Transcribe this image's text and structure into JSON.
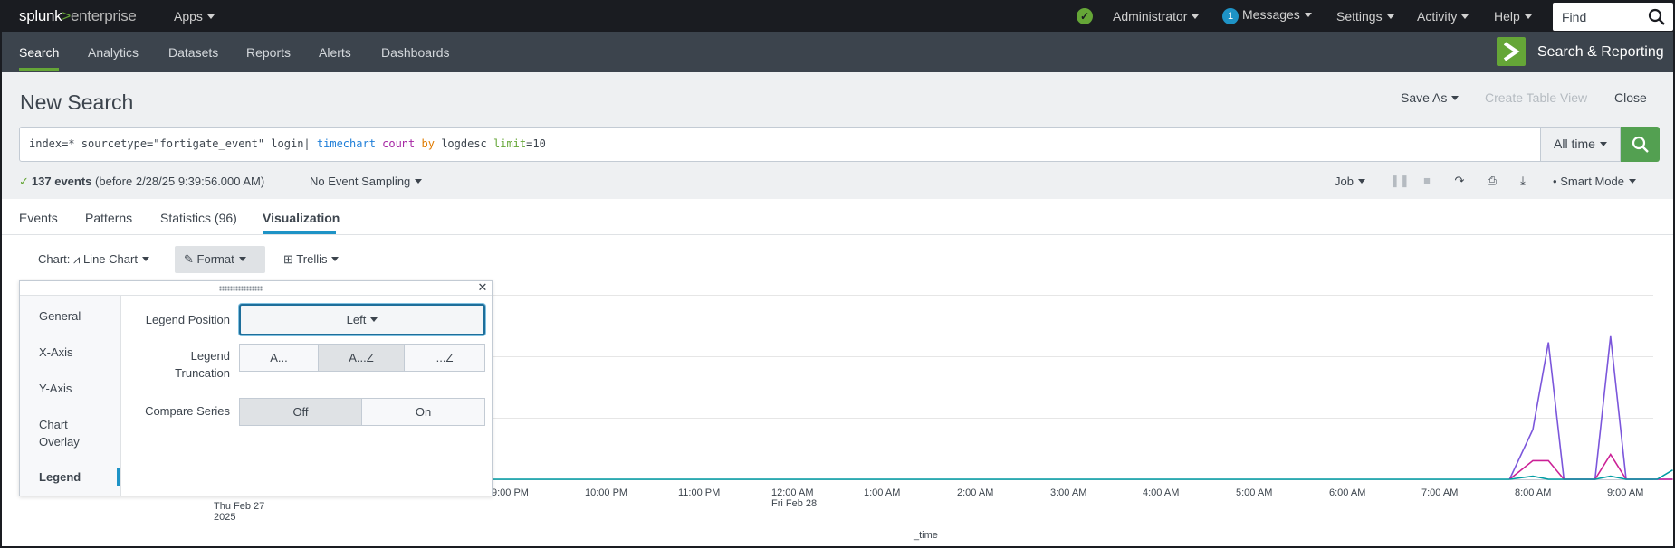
{
  "topbar": {
    "logo_splunk": "splunk",
    "logo_gt": ">",
    "logo_enterprise": "enterprise",
    "apps": "Apps",
    "administrator": "Administrator",
    "messages_count": "1",
    "messages": "Messages",
    "settings": "Settings",
    "activity": "Activity",
    "help": "Help",
    "find_placeholder": "Find"
  },
  "appbar": {
    "items": [
      "Search",
      "Analytics",
      "Datasets",
      "Reports",
      "Alerts",
      "Dashboards"
    ],
    "app_title": "Search & Reporting"
  },
  "search": {
    "title": "New Search",
    "save_as": "Save As",
    "create_table_view": "Create Table View",
    "close": "Close",
    "query": {
      "base": "index=* sourcetype=\"fortigate_event\" login| ",
      "cmd": "timechart",
      "fn": "count",
      "by": "by",
      "field": " logdesc ",
      "arg": "limit",
      "rest": "=10"
    },
    "time_range": "All time",
    "events_count": "137 events",
    "events_detail": "(before 2/28/25 9:39:56.000 AM)",
    "sampling": "No Event Sampling",
    "job": "Job",
    "mode": "Smart Mode"
  },
  "tabs": [
    "Events",
    "Patterns",
    "Statistics (96)",
    "Visualization"
  ],
  "chart_toolbar": {
    "chart": "Chart: ⩘ Line Chart",
    "format": "Format",
    "trellis": "Trellis"
  },
  "format_panel": {
    "nav": [
      "General",
      "X-Axis",
      "Y-Axis",
      "Chart Overlay",
      "Legend"
    ],
    "active": "Legend",
    "legend_position_label": "Legend Position",
    "legend_position_value": "Left",
    "legend_truncation_label": "Legend Truncation",
    "truncation_options": [
      "A...",
      "A...Z",
      "...Z"
    ],
    "truncation_selected": "A...Z",
    "compare_series_label": "Compare Series",
    "compare_options": [
      "Off",
      "On"
    ],
    "compare_selected": "Off"
  },
  "chart_data": {
    "type": "line",
    "xlabel": "_time",
    "x_ticks": [
      "Thu Feb 27\n2025",
      "9:00 PM",
      "10:00 PM",
      "11:00 PM",
      "12:00 AM\nFri Feb 28",
      "1:00 AM",
      "2:00 AM",
      "3:00 AM",
      "4:00 AM",
      "5:00 AM",
      "6:00 AM",
      "7:00 AM",
      "8:00 AM",
      "9:00 AM"
    ],
    "x": [
      "7:45 AM",
      "8:00 AM",
      "8:10 AM",
      "8:20 AM",
      "8:30 AM",
      "8:40 AM",
      "8:50 AM",
      "9:00 AM",
      "9:10 AM",
      "9:20 AM",
      "9:30 AM"
    ],
    "series": [
      {
        "color": "#7b56db",
        "values": [
          0,
          8,
          22,
          0,
          0,
          0,
          23,
          0,
          0,
          0,
          0
        ]
      },
      {
        "color": "#cb2196",
        "values": [
          0,
          3,
          3,
          0,
          0,
          0,
          4,
          0,
          0,
          0,
          0
        ]
      },
      {
        "color": "#009ca3",
        "values": [
          0,
          0.5,
          0,
          0,
          0,
          0,
          0.5,
          0,
          0,
          0,
          1.5
        ]
      }
    ],
    "ylim": [
      0,
      25
    ],
    "grid": true
  }
}
